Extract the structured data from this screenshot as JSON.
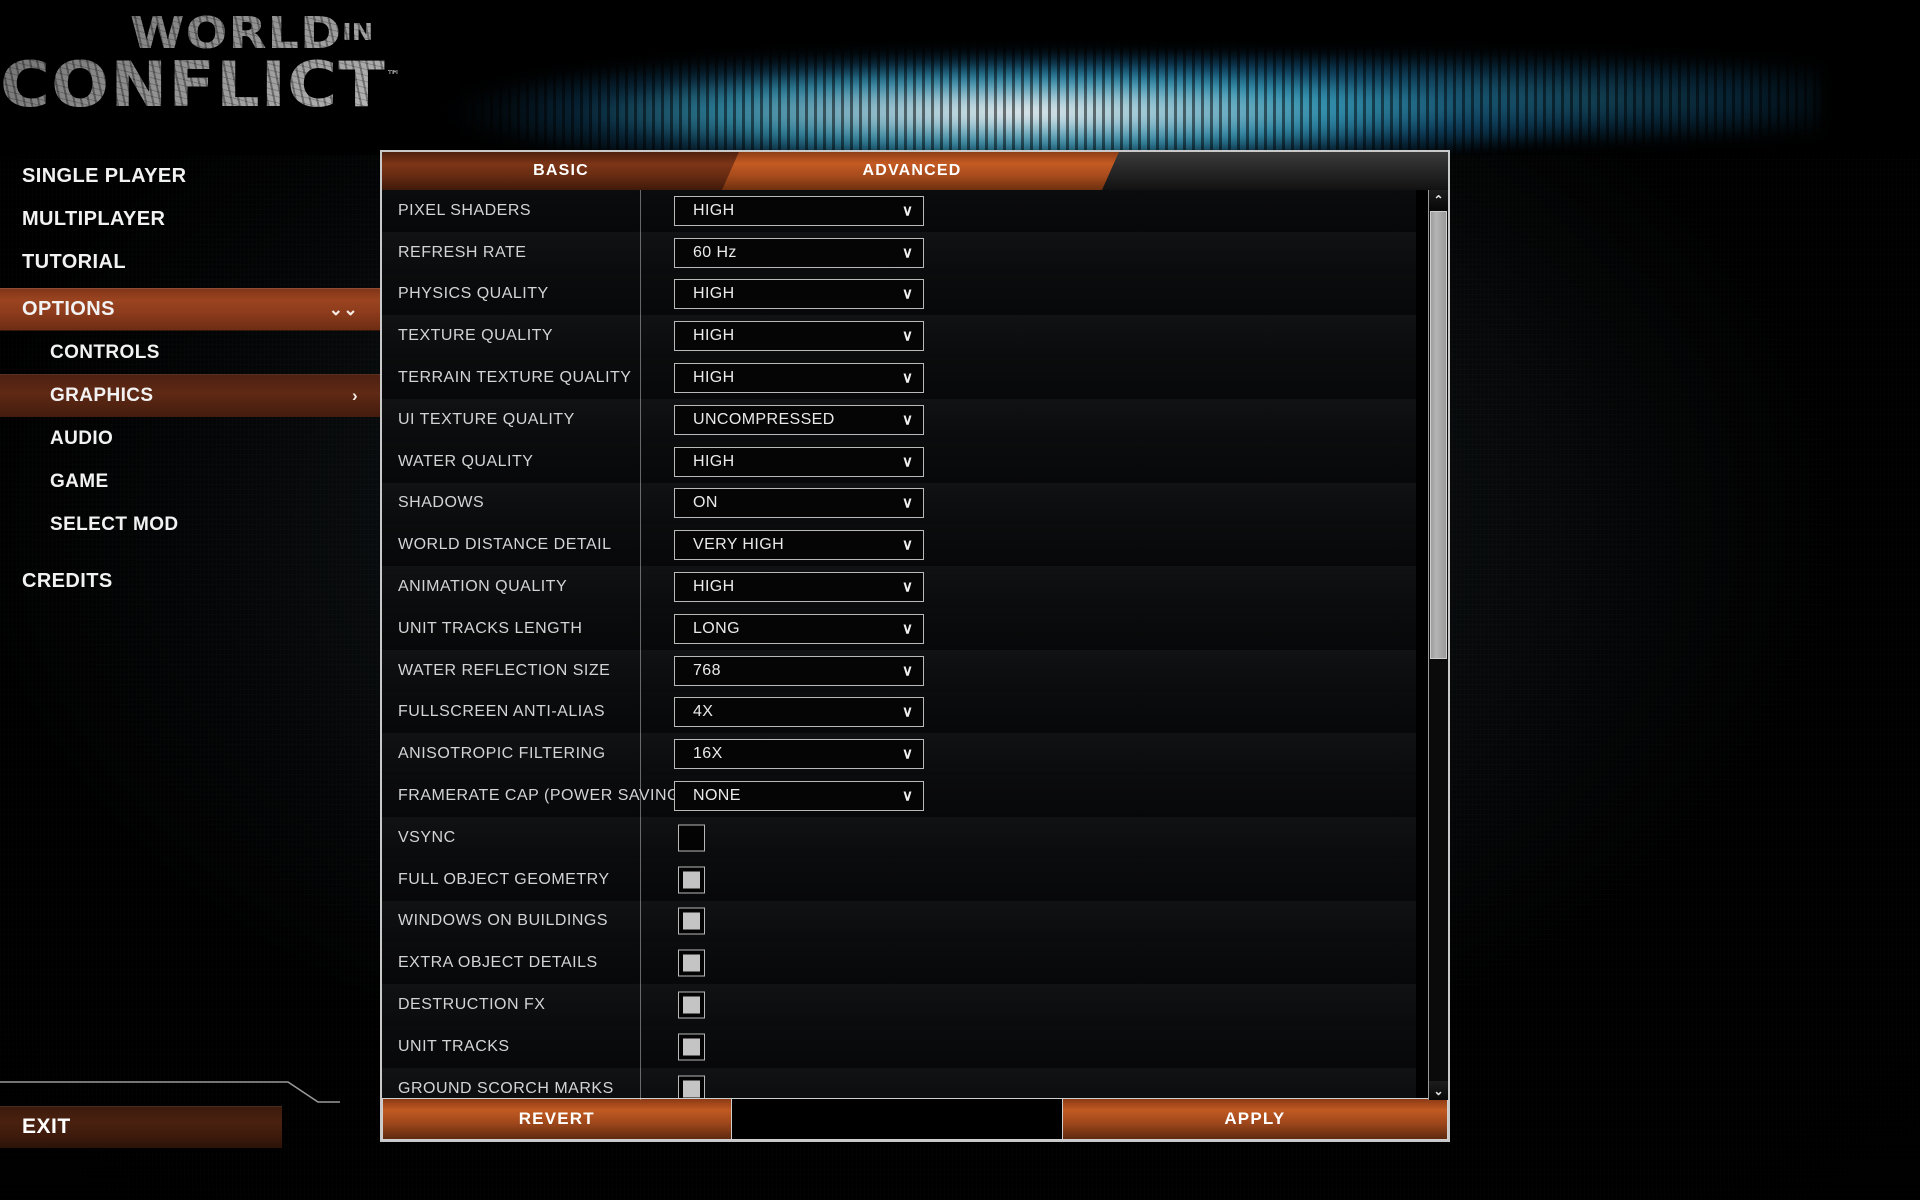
{
  "logo": {
    "line1_main": "WORLD",
    "line1_sub": "IN",
    "line2": "CONFLICT",
    "tm": "™"
  },
  "sidebar": {
    "items": [
      {
        "label": "SINGLE PLAYER",
        "level": "top",
        "state": "normal",
        "chevron": ""
      },
      {
        "label": "MULTIPLAYER",
        "level": "top",
        "state": "normal",
        "chevron": ""
      },
      {
        "label": "TUTORIAL",
        "level": "top",
        "state": "normal",
        "chevron": ""
      },
      {
        "label": "OPTIONS",
        "level": "top",
        "state": "active",
        "chevron": "⌄⌄"
      },
      {
        "label": "CONTROLS",
        "level": "sub",
        "state": "normal",
        "chevron": ""
      },
      {
        "label": "GRAPHICS",
        "level": "sub",
        "state": "active-sub",
        "chevron": "›"
      },
      {
        "label": "AUDIO",
        "level": "sub",
        "state": "normal",
        "chevron": ""
      },
      {
        "label": "GAME",
        "level": "sub",
        "state": "normal",
        "chevron": ""
      },
      {
        "label": "SELECT MOD",
        "level": "sub",
        "state": "normal",
        "chevron": ""
      },
      {
        "label": "CREDITS",
        "level": "top",
        "state": "normal",
        "chevron": ""
      }
    ],
    "exit_label": "EXIT"
  },
  "tabs": [
    {
      "label": "BASIC",
      "active": false
    },
    {
      "label": "ADVANCED",
      "active": true
    }
  ],
  "settings": [
    {
      "label": "PIXEL SHADERS",
      "type": "select",
      "value": "HIGH"
    },
    {
      "label": "REFRESH RATE",
      "type": "select",
      "value": "60 Hz"
    },
    {
      "label": "PHYSICS QUALITY",
      "type": "select",
      "value": "HIGH"
    },
    {
      "label": "TEXTURE QUALITY",
      "type": "select",
      "value": "HIGH"
    },
    {
      "label": "TERRAIN TEXTURE QUALITY",
      "type": "select",
      "value": "HIGH"
    },
    {
      "label": "UI TEXTURE QUALITY",
      "type": "select",
      "value": "UNCOMPRESSED"
    },
    {
      "label": "WATER QUALITY",
      "type": "select",
      "value": "HIGH"
    },
    {
      "label": "SHADOWS",
      "type": "select",
      "value": "ON"
    },
    {
      "label": "WORLD DISTANCE DETAIL",
      "type": "select",
      "value": "VERY HIGH"
    },
    {
      "label": "ANIMATION QUALITY",
      "type": "select",
      "value": "HIGH"
    },
    {
      "label": "UNIT TRACKS LENGTH",
      "type": "select",
      "value": "LONG"
    },
    {
      "label": "WATER REFLECTION SIZE",
      "type": "select",
      "value": "768"
    },
    {
      "label": "FULLSCREEN ANTI-ALIAS",
      "type": "select",
      "value": "4X"
    },
    {
      "label": "ANISOTROPIC FILTERING",
      "type": "select",
      "value": "16X"
    },
    {
      "label": "FRAMERATE CAP (POWER SAVING)",
      "type": "select",
      "value": "NONE"
    },
    {
      "label": "VSYNC",
      "type": "checkbox",
      "checked": false
    },
    {
      "label": "FULL OBJECT GEOMETRY",
      "type": "checkbox",
      "checked": true
    },
    {
      "label": "WINDOWS ON BUILDINGS",
      "type": "checkbox",
      "checked": true
    },
    {
      "label": "EXTRA OBJECT DETAILS",
      "type": "checkbox",
      "checked": true
    },
    {
      "label": "DESTRUCTION FX",
      "type": "checkbox",
      "checked": true
    },
    {
      "label": "UNIT TRACKS",
      "type": "checkbox",
      "checked": true
    },
    {
      "label": "GROUND SCORCH MARKS",
      "type": "checkbox",
      "checked": true
    }
  ],
  "scrollbar": {
    "up_arrow": "⌃",
    "down_arrow": "⌄"
  },
  "buttons": {
    "revert": "REVERT",
    "apply": "APPLY"
  },
  "dropdown_chevron": "∨",
  "colors": {
    "accent_orange": "#c05a22",
    "accent_dark": "#7d3517",
    "panel_border": "#c9c9c9",
    "text": "#d4d4d4",
    "glow_cyan": "#3fb2d6"
  }
}
